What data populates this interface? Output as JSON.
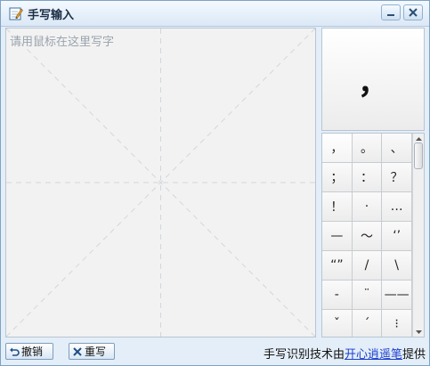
{
  "window": {
    "title": "手写输入",
    "icon": "pencil-icon",
    "minimize_icon": "minimize-icon",
    "close_icon": "close-icon"
  },
  "canvas": {
    "hint": "请用鼠标在这里写字"
  },
  "preview": {
    "char": "，"
  },
  "candidates": [
    "，",
    "。",
    "、",
    "；",
    "：",
    "？",
    "！",
    "·",
    "…",
    "—",
    "～",
    "‘’",
    "“”",
    "/",
    "\\",
    "-",
    "¨",
    "——",
    "ˇ",
    "ˊ",
    "⁝"
  ],
  "buttons": {
    "undo_label": "撤销",
    "rewrite_label": "重写"
  },
  "credit": {
    "prefix": "手写识别技术由",
    "link": "开心逍遥笔",
    "suffix": "提供"
  },
  "colors": {
    "link": "#1b3fd0",
    "frame": "#7fa2c6"
  }
}
